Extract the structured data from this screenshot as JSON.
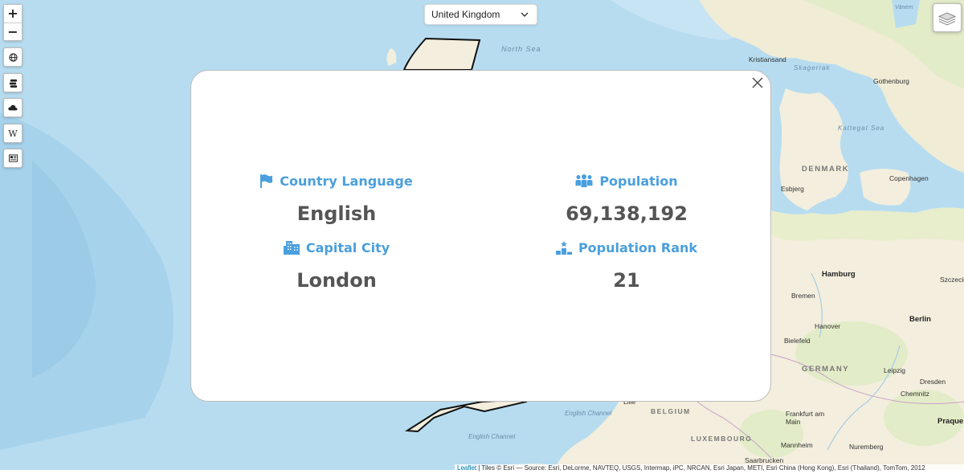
{
  "country_select": {
    "selected": "United Kingdom"
  },
  "controls": {
    "zoom_in": "+",
    "zoom_out": "−",
    "wiki_glyph": "W"
  },
  "map_labels": {
    "seas": [
      "North Sea",
      "Skagerrak",
      "Kattegat Sea",
      "English Channel",
      "English Channel"
    ],
    "countries": [
      "DENMARK",
      "GERMANY",
      "BELGIUM",
      "LUXEMBOURG"
    ],
    "cities": [
      "Kristiansand",
      "Gothenburg",
      "Vänern",
      "Esbjerg",
      "Copenhagen",
      "Hamburg",
      "Bremen",
      "Hanover",
      "Berlin",
      "Bielefeld",
      "Leipzig",
      "Dresden",
      "Chemnitz",
      "Frankfurt am Main",
      "Mannheim",
      "Nuremberg",
      "Saarbrucken",
      "Praque",
      "Szczecin",
      "Lille"
    ]
  },
  "modal": {
    "language": {
      "label": "Country Language",
      "value": "English",
      "icon": "flag-icon"
    },
    "population": {
      "label": "Population",
      "value": "69,138,192",
      "icon": "people-icon"
    },
    "capital": {
      "label": "Capital City",
      "value": "London",
      "icon": "city-icon"
    },
    "rank": {
      "label": "Population Rank",
      "value": "21",
      "icon": "podium-icon"
    }
  },
  "attribution": {
    "leaflet": "Leaflet",
    "text": " | Tiles © Esri — Source: Esri, DeLorme, NAVTEQ, USGS, Intermap, iPC, NRCAN, Esri Japan, METI, Esri China (Hong Kong), Esri (Thailand), TomTom, 2012"
  },
  "colors": {
    "accent": "#4a9fdc",
    "sea": "#b7dcf0",
    "land": "#f3eedd",
    "value_text": "#555555"
  }
}
